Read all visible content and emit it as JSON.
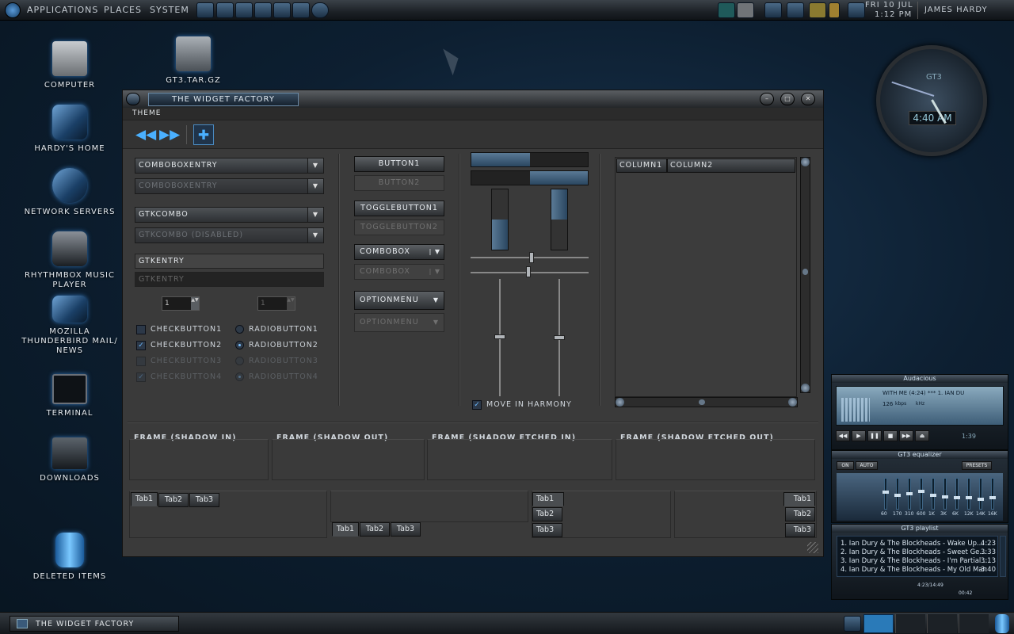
{
  "top_panel": {
    "menus": [
      "Applications",
      "Places",
      "System"
    ],
    "clock_line1": "Fri 10 Jul",
    "clock_line2": "1:12 PM",
    "user": "James Hardy"
  },
  "desktop": {
    "icons": [
      {
        "label": "Computer",
        "icon": "computer-icon"
      },
      {
        "label": "GT3.tar.gz",
        "icon": "archive-icon"
      },
      {
        "label": "Hardy's Home",
        "icon": "home-folder-icon"
      },
      {
        "label": "Network Servers",
        "icon": "network-icon"
      },
      {
        "label": "Rhythmbox Music Player",
        "icon": "music-player-icon"
      },
      {
        "label": "Mozilla Thunderbird Mail/ News",
        "icon": "mail-icon"
      },
      {
        "label": "Terminal",
        "icon": "terminal-icon"
      },
      {
        "label": "Downloads",
        "icon": "downloads-icon"
      },
      {
        "label": "Deleted Items",
        "icon": "trash-icon"
      }
    ]
  },
  "clock_widget": {
    "brand": "GT3",
    "time": "4:40 AM"
  },
  "window": {
    "title": "The Widget Factory",
    "menu": "Theme",
    "combos": [
      "comboboxentry",
      "comboboxentry",
      "gtkcombo",
      "gtkcombo (disabled)"
    ],
    "entries": [
      "gtkentry",
      "gtkentry"
    ],
    "spin_values": [
      "1",
      "1"
    ],
    "checks": [
      "checkbutton1",
      "checkbutton2",
      "checkbutton3",
      "checkbutton4"
    ],
    "radios": [
      "radiobutton1",
      "radiobutton2",
      "radiobutton3",
      "radiobutton4"
    ],
    "buttons": [
      "button1",
      "button2"
    ],
    "toggles": [
      "togglebutton1",
      "togglebutton2"
    ],
    "combobox": [
      "combobox",
      "combobox"
    ],
    "optionmenu": [
      "optionmenu",
      "optionmenu"
    ],
    "move_harmony": "Move in harmony",
    "columns": [
      "column1",
      "column2"
    ],
    "frames": [
      "Frame (shadow in)",
      "Frame (shadow out)",
      "Frame (shadow etched in)",
      "Frame (shadow etched out)"
    ],
    "tabs": [
      "Tab1",
      "Tab2",
      "Tab3"
    ]
  },
  "taskbar": {
    "task": "The Widget Factory"
  },
  "audacious": {
    "title": "Audacious",
    "song": "WITH ME (4:24) *** 1. IAN DU",
    "bitrate": "126",
    "kbps": "kbps",
    "khz": "kHz",
    "time_display": "1:39",
    "eq_title": "GT3 equalizer",
    "eq_on": "ON",
    "eq_auto": "AUTO",
    "eq_presets": "PRESETS",
    "eq_labels": [
      "60",
      "170",
      "310",
      "600",
      "1K",
      "3K",
      "6K",
      "12K",
      "14K",
      "16K"
    ],
    "eq_levels": [
      0.55,
      0.45,
      0.5,
      0.58,
      0.45,
      0.4,
      0.35,
      0.35,
      0.3,
      0.35
    ],
    "playlist_title": "GT3 playlist",
    "playlist": [
      {
        "title": "1. Ian Dury & The Blockheads - Wake Up...",
        "time": "4:23"
      },
      {
        "title": "2. Ian Dury & The Blockheads - Sweet Ge...",
        "time": "3:33"
      },
      {
        "title": "3. Ian Dury & The Blockheads - I'm Partial ...",
        "time": "3:13"
      },
      {
        "title": "4. Ian Dury & The Blockheads - My Old Man",
        "time": "3:40"
      }
    ],
    "pl_info": "4:23/14:49",
    "pl_time": "00:42"
  }
}
